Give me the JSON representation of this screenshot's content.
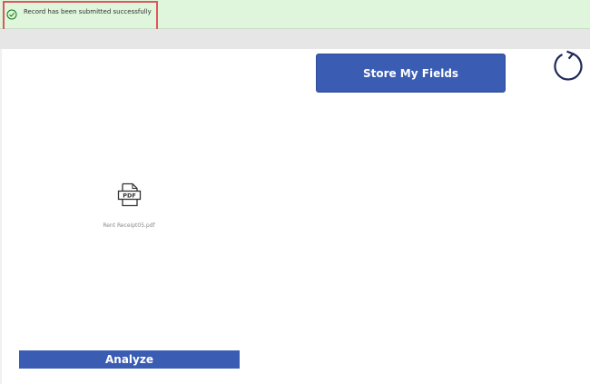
{
  "notification": {
    "message": "Record has been submitted successfully",
    "icon": "check-circle-icon",
    "status_color": "#107c10"
  },
  "toolbar": {
    "store_label": "Store My Fields",
    "refresh_icon": "refresh-icon"
  },
  "attachment": {
    "icon": "pdf-file-icon",
    "filename": "Rent Receipt05.pdf"
  },
  "actions": {
    "analyze_label": "Analyze"
  },
  "colors": {
    "banner_bg": "#dff6dd",
    "button_bg": "#3a5cb3",
    "highlight": "#e0555b",
    "refresh": "#1f2a5a"
  }
}
